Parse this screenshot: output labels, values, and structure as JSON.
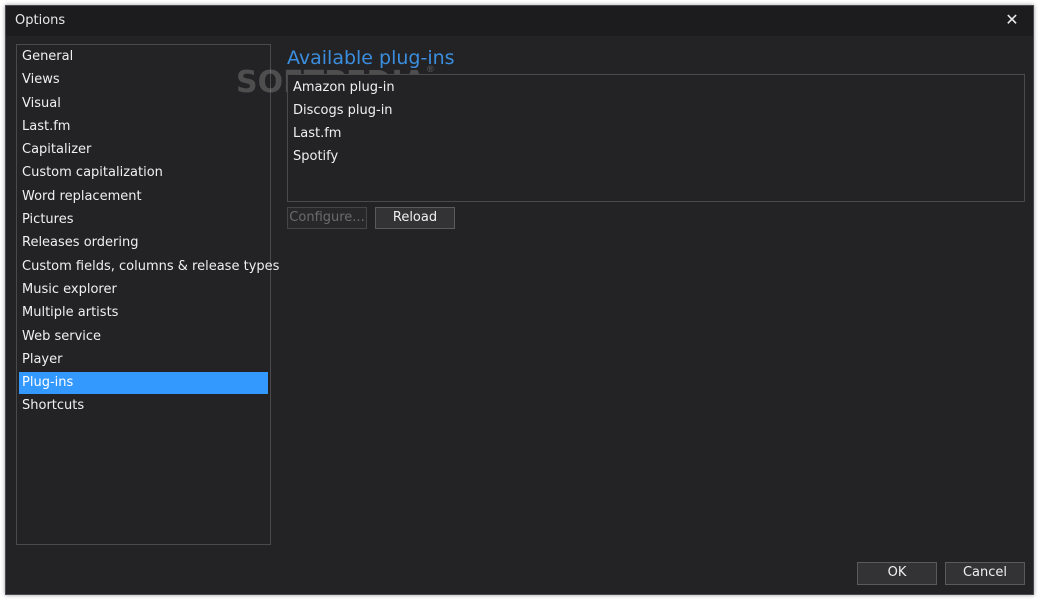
{
  "window": {
    "title": "Options",
    "close_symbol": "✕"
  },
  "sidebar": {
    "items": [
      {
        "label": "General"
      },
      {
        "label": "Views"
      },
      {
        "label": "Visual"
      },
      {
        "label": "Last.fm"
      },
      {
        "label": "Capitalizer"
      },
      {
        "label": "Custom capitalization"
      },
      {
        "label": "Word replacement"
      },
      {
        "label": "Pictures"
      },
      {
        "label": "Releases ordering"
      },
      {
        "label": "Custom fields, columns & release types"
      },
      {
        "label": "Music explorer"
      },
      {
        "label": "Multiple artists"
      },
      {
        "label": "Web service"
      },
      {
        "label": "Player"
      },
      {
        "label": "Plug-ins",
        "selected": true
      },
      {
        "label": "Shortcuts"
      }
    ]
  },
  "main": {
    "heading": "Available plug-ins",
    "plugins": [
      {
        "name": "Amazon plug-in"
      },
      {
        "name": "Discogs plug-in"
      },
      {
        "name": "Last.fm"
      },
      {
        "name": "Spotify"
      }
    ],
    "configure_label": "Configure...",
    "reload_label": "Reload"
  },
  "footer": {
    "ok_label": "OK",
    "cancel_label": "Cancel"
  },
  "watermark": {
    "text": "SOFTPEDIA",
    "mark": "®"
  },
  "colors": {
    "background": "#232325",
    "titlebar": "#1c1c1e",
    "accent_heading": "#3b8edf",
    "selection": "#3399ff",
    "text": "#f0f0f0"
  },
  "icons": {
    "close": "close-icon"
  }
}
